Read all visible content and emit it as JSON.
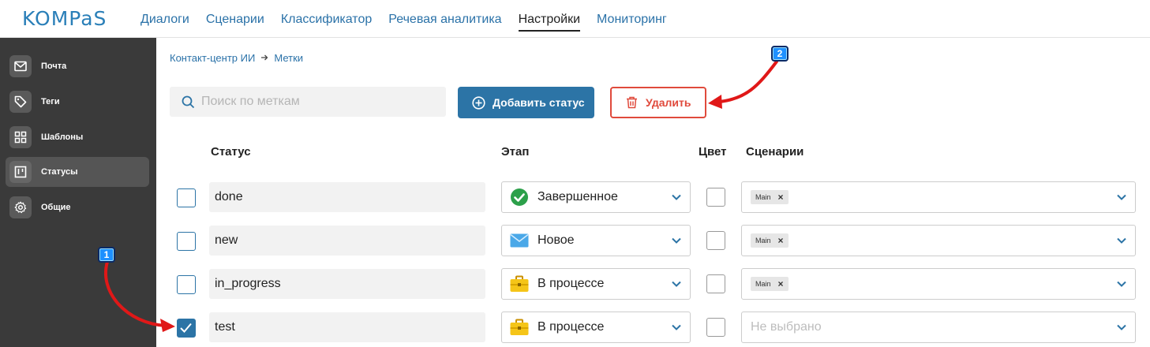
{
  "app": {
    "logo": "KOMPaS"
  },
  "nav": [
    "Диалоги",
    "Сценарии",
    "Классификатор",
    "Речевая аналитика",
    "Настройки",
    "Мониторинг"
  ],
  "nav_active": "Настройки",
  "sidebar": {
    "items": [
      {
        "label": "Почта",
        "icon": "mail-icon"
      },
      {
        "label": "Теги",
        "icon": "tag-icon"
      },
      {
        "label": "Шаблоны",
        "icon": "grid-icon"
      },
      {
        "label": "Статусы",
        "icon": "kanban-icon",
        "active": true
      },
      {
        "label": "Общие",
        "icon": "gear-icon"
      }
    ]
  },
  "breadcrumb": {
    "parent": "Контакт-центр ИИ",
    "current": "Метки"
  },
  "search": {
    "placeholder": "Поиск по меткам",
    "value": ""
  },
  "toolbar": {
    "add_label": "Добавить статус",
    "delete_label": "Удалить"
  },
  "table": {
    "headers": {
      "status": "Статус",
      "stage": "Этап",
      "color": "Цвет",
      "scenarios": "Сценарии"
    },
    "rows": [
      {
        "name": "done",
        "stage": "Завершенное",
        "stage_icon": "check-circle-icon",
        "checked": false,
        "scenarios": [
          "Main"
        ]
      },
      {
        "name": "new",
        "stage": "Новое",
        "stage_icon": "envelope-icon",
        "checked": false,
        "scenarios": [
          "Main"
        ]
      },
      {
        "name": "in_progress",
        "stage": "В процессе",
        "stage_icon": "briefcase-icon",
        "checked": false,
        "scenarios": [
          "Main"
        ]
      },
      {
        "name": "test",
        "stage": "В процессе",
        "stage_icon": "briefcase-icon",
        "checked": true,
        "scenarios": []
      }
    ],
    "scenario_placeholder": "Не выбрано"
  },
  "annotations": {
    "badge1": "1",
    "badge2": "2"
  },
  "colors": {
    "accent": "#2c74a6",
    "danger": "#e04a3c",
    "sidebar_bg": "#3a3a3a",
    "success": "#2ca04a",
    "briefcase": "#f5c518"
  }
}
